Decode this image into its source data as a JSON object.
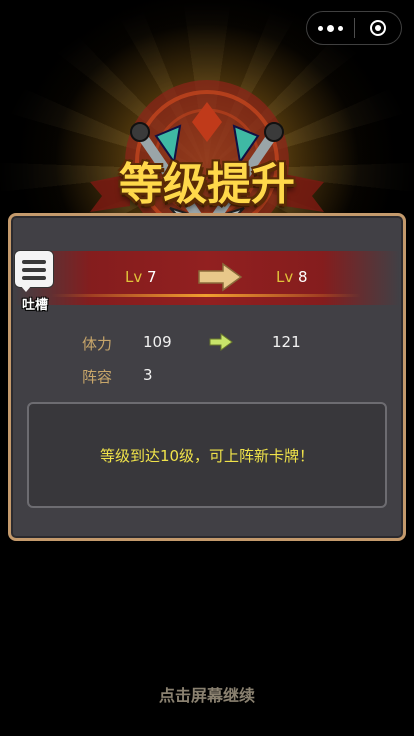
{
  "capsule": {
    "more_icon": "more-dots-icon",
    "close_icon": "close-target-icon"
  },
  "banner": {
    "title": "等级提升"
  },
  "level": {
    "prefix": "Lv",
    "old": "7",
    "new": "8"
  },
  "stats": [
    {
      "label": "体力",
      "old": "109",
      "new": "121"
    },
    {
      "label": "阵容",
      "value": "3"
    }
  ],
  "message": "等级到达10级，可上阵新卡牌！",
  "feedback": {
    "label": "吐槽"
  },
  "footer": {
    "continue": "点击屏幕继续"
  },
  "colors": {
    "accent_gold": "#ffd84a",
    "panel_border": "#c49a6c",
    "message": "#f0e34a"
  }
}
